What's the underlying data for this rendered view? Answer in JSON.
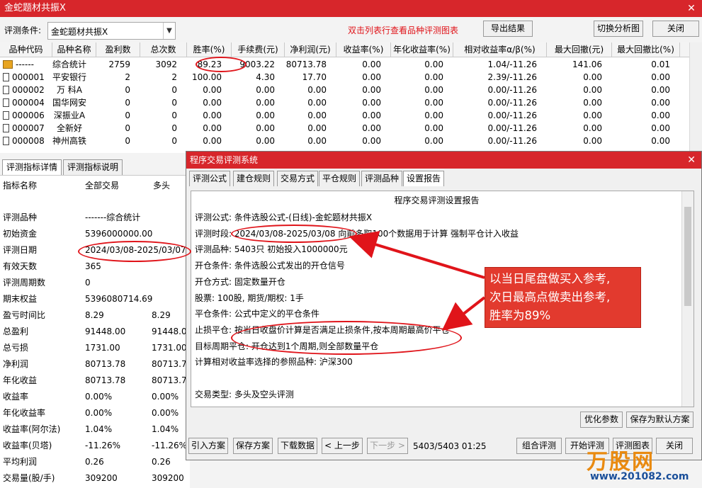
{
  "window": {
    "title": "金蛇题材共振X",
    "close": "✕"
  },
  "toolbar": {
    "condition_label": "评测条件:",
    "condition_value": "金蛇题材共振X",
    "hint": "双击列表行查看品种评测图表",
    "export": "导出结果",
    "switch_chart": "切换分析图",
    "close": "关闭"
  },
  "grid": {
    "columns": [
      "品种代码",
      "品种名称",
      "盈利数",
      "总次数",
      "胜率(%)",
      "手续费(元)",
      "净利润(元)",
      "收益率(%)",
      "年化收益率(%)",
      "相对收益率α/β(%)",
      "最大回撤(元)",
      "最大回撤比(%)"
    ],
    "rows": [
      [
        "------",
        "综合统计",
        "2759",
        "3092",
        "89.23",
        "9003.22",
        "80713.78",
        "0.00",
        "0.00",
        "1.04/-11.26",
        "141.06",
        "0.01"
      ],
      [
        "000001",
        "平安银行",
        "2",
        "2",
        "100.00",
        "4.30",
        "17.70",
        "0.00",
        "0.00",
        "2.39/-11.26",
        "0.00",
        "0.00"
      ],
      [
        "000002",
        "万 科A",
        "0",
        "0",
        "0.00",
        "0.00",
        "0.00",
        "0.00",
        "0.00",
        "0.00/-11.26",
        "0.00",
        "0.00"
      ],
      [
        "000004",
        "国华网安",
        "0",
        "0",
        "0.00",
        "0.00",
        "0.00",
        "0.00",
        "0.00",
        "0.00/-11.26",
        "0.00",
        "0.00"
      ],
      [
        "000006",
        "深振业A",
        "0",
        "0",
        "0.00",
        "0.00",
        "0.00",
        "0.00",
        "0.00",
        "0.00/-11.26",
        "0.00",
        "0.00"
      ],
      [
        "000007",
        "全新好",
        "0",
        "0",
        "0.00",
        "0.00",
        "0.00",
        "0.00",
        "0.00",
        "0.00/-11.26",
        "0.00",
        "0.00"
      ],
      [
        "000008",
        "神州高铁",
        "0",
        "0",
        "0.00",
        "0.00",
        "0.00",
        "0.00",
        "0.00",
        "0.00/-11.26",
        "0.00",
        "0.00"
      ]
    ]
  },
  "left_tabs": [
    "评测指标详情",
    "评测指标说明"
  ],
  "left_panel": {
    "headers": [
      "指标名称",
      "全部交易",
      "多头"
    ],
    "rows": [
      [
        "评测品种",
        "-------综合统计",
        ""
      ],
      [
        "初始资金",
        "5396000000.00",
        ""
      ],
      [
        "评测日期",
        "2024/03/08-2025/03/07",
        ""
      ],
      [
        "有效天数",
        "365",
        ""
      ],
      [
        "评测周期数",
        "0",
        ""
      ],
      [
        "期末权益",
        "5396080714.69",
        ""
      ],
      [
        "盈亏时间比",
        "8.29",
        "8.29"
      ],
      [
        "总盈利",
        "91448.00",
        "91448.0"
      ],
      [
        "总亏损",
        "1731.00",
        "1731.00"
      ],
      [
        "净利润",
        "80713.78",
        "80713.7"
      ],
      [
        "年化收益",
        "80713.78",
        "80713.7"
      ],
      [
        "收益率",
        "0.00%",
        "0.00%"
      ],
      [
        "年化收益率",
        "0.00%",
        "0.00%"
      ],
      [
        "收益率(阿尔法)",
        "1.04%",
        "1.04%"
      ],
      [
        "收益率(贝塔)",
        "-11.26%",
        "-11.26%"
      ],
      [
        "平均利润",
        "0.26",
        "0.26"
      ],
      [
        "交易量(股/手)",
        "309200",
        "309200"
      ]
    ]
  },
  "dialog": {
    "title": "程序交易评测系统",
    "close": "✕",
    "tabs": [
      "评测公式",
      "建仓规则",
      "交易方式",
      "平仓规则",
      "评测品种",
      "设置报告"
    ],
    "report": {
      "heading": "程序交易评测设置报告",
      "lines": [
        "评测公式: 条件选股公式-(日线)-金蛇题材共振X",
        "评测时段: 2024/03/08-2025/03/08 向前多取100个数据用于计算 强制平仓计入收益",
        "评测品种: 5403只 初始投入1000000元",
        "开仓条件: 条件选股公式发出的开仓信号",
        "开仓方式: 固定数量开仓",
        "              股票: 100股, 期货/期权: 1手",
        "平仓条件: 公式中定义的平仓条件",
        "止损平仓: 按当日收盘价计算是否满足止损条件,按本周期最高价平仓",
        "              目标周期平仓: 开仓达到1个周期,则全部数量平仓",
        "              计算相对收益率选择的参照品种: 沪深300",
        "",
        "交易类型: 多头及空头评测"
      ]
    },
    "buttons": {
      "optimize": "优化参数",
      "save_default": "保存为默认方案",
      "import": "引入方案",
      "save": "保存方案",
      "download": "下载数据",
      "prev": "< 上一步",
      "next": "下一步 >",
      "progress": "5403/5403  01:25",
      "combo_eval": "组合评测",
      "start_eval": "开始评测",
      "eval_chart": "评测图表",
      "close": "关闭"
    }
  },
  "callout": {
    "lines": [
      "以当日尾盘做买入参考,",
      "次日最高点做卖出参考,",
      "胜率为89%"
    ],
    "color": "#e23a2e"
  },
  "watermark": {
    "brand": "万股网",
    "url": "www.201082.com"
  }
}
